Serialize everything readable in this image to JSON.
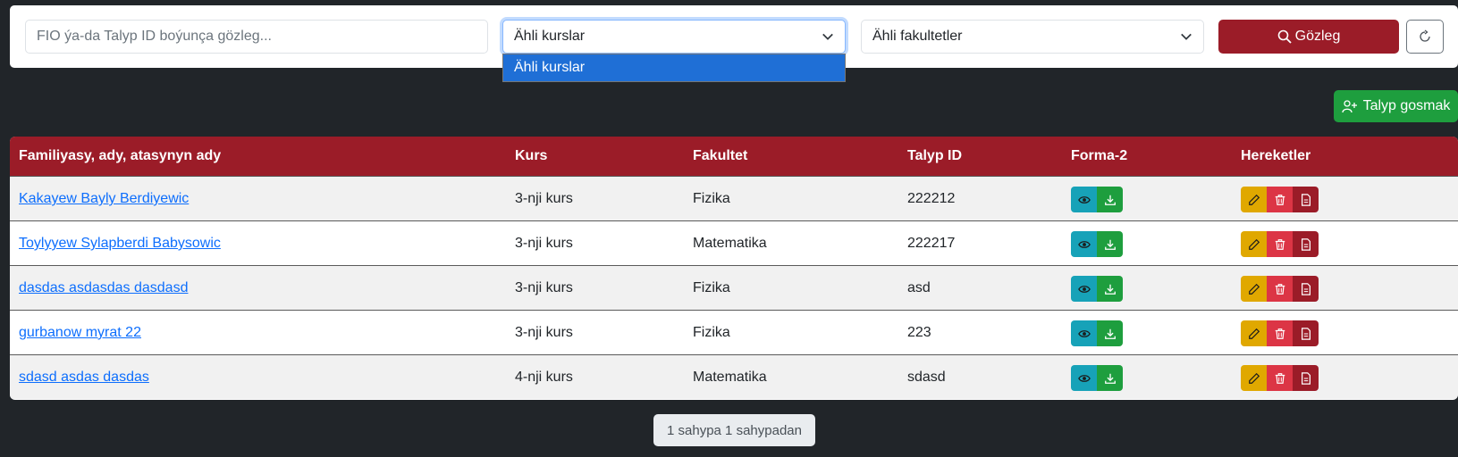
{
  "filters": {
    "search_placeholder": "FIO ýa-da Talyp ID boýunça gözleg...",
    "courses_selected": "Ähli kurslar",
    "courses_options": [
      "Ähli kurslar"
    ],
    "faculties_selected": "Ähli fakultetler",
    "search_button": "Gözleg"
  },
  "add_button": "Talyp gosmak",
  "table": {
    "headers": [
      "Familiyasy, ady, atasynyn ady",
      "Kurs",
      "Fakultet",
      "Talyp ID",
      "Forma-2",
      "Hereketler"
    ],
    "rows": [
      {
        "name": "Kakayew Bayly Berdiyewic",
        "course": "3-nji kurs",
        "faculty": "Fizika",
        "id": "222212"
      },
      {
        "name": "Toylyyew Sylapberdi Babysowic",
        "course": "3-nji kurs",
        "faculty": "Matematika",
        "id": "222217"
      },
      {
        "name": "dasdas asdasdas dasdasd",
        "course": "3-nji kurs",
        "faculty": "Fizika",
        "id": "asd"
      },
      {
        "name": "gurbanow myrat 22",
        "course": "3-nji kurs",
        "faculty": "Fizika",
        "id": "223"
      },
      {
        "name": "sdasd asdas dasdas",
        "course": "4-nji kurs",
        "faculty": "Matematika",
        "id": "sdasd"
      }
    ]
  },
  "pagination": "1 sahypa 1 sahypadan",
  "colors": {
    "brand": "#9b1c28",
    "success": "#1e9e3e",
    "info": "#17a2b8",
    "warning": "#e0a800",
    "danger": "#dc3545",
    "link": "#0d6efd"
  }
}
